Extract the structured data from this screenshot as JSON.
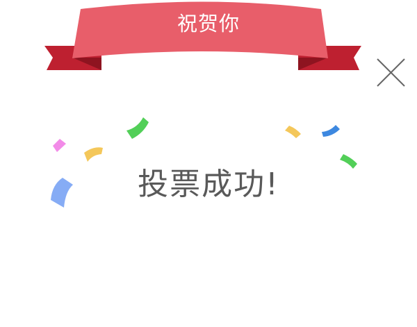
{
  "dialog": {
    "banner_title": "祝贺你",
    "message": "投票成功!",
    "close_icon": "close-icon"
  },
  "colors": {
    "ribbon_main": "#e85e6a",
    "ribbon_tail": "#be2030",
    "ribbon_fold": "#8e1420",
    "message_text": "#595959",
    "close_stroke": "#666666",
    "confetti": [
      "#f28be8",
      "#f4c75a",
      "#52cf58",
      "#86acf5",
      "#3d88e0"
    ]
  }
}
